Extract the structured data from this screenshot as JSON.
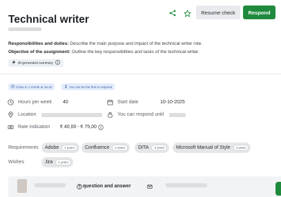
{
  "header": {
    "title": "Technical writer",
    "resume_check_label": "Resume check",
    "respond_label": "Respond"
  },
  "description": {
    "responsibilities_label": "Responsibilities and duties:",
    "responsibilities_text": " Describe the main purpose and impact of the technical writer role.",
    "objective_label": "Objective of the assignment:",
    "objective_text": " Outline the key responsibilities and tasks of the technical writer.",
    "ai_badge_label": "AI-generated summary"
  },
  "tags": {
    "close_label": "Close in 1 month at 15:42",
    "first_label": "You can be the first to respond"
  },
  "details": {
    "hours_label": "Hours per week",
    "hours_value": "40",
    "start_label": "Start date",
    "start_value": "10-10-2025",
    "location_label": "Location",
    "respond_until_label": "You can respond until",
    "rate_label": "Rate indication",
    "rate_value": "€ 40,00 - € 75,00"
  },
  "requirements": {
    "label": "Requirements",
    "items": [
      {
        "name": "Adobe",
        "years": "1 years"
      },
      {
        "name": "Confluence",
        "years": "2 years"
      },
      {
        "name": "DITA",
        "years": "3 years"
      },
      {
        "name": "Microsoft Manual of Style",
        "years": "4 years"
      }
    ]
  },
  "wishes": {
    "label": "Wishes",
    "items": [
      {
        "name": "Jira",
        "years": "1 years"
      }
    ]
  },
  "footer": {
    "qa_label": "question and answer"
  },
  "colors": {
    "accent_green": "#1f8a3d",
    "tag_blue": "#3d5fa6"
  }
}
